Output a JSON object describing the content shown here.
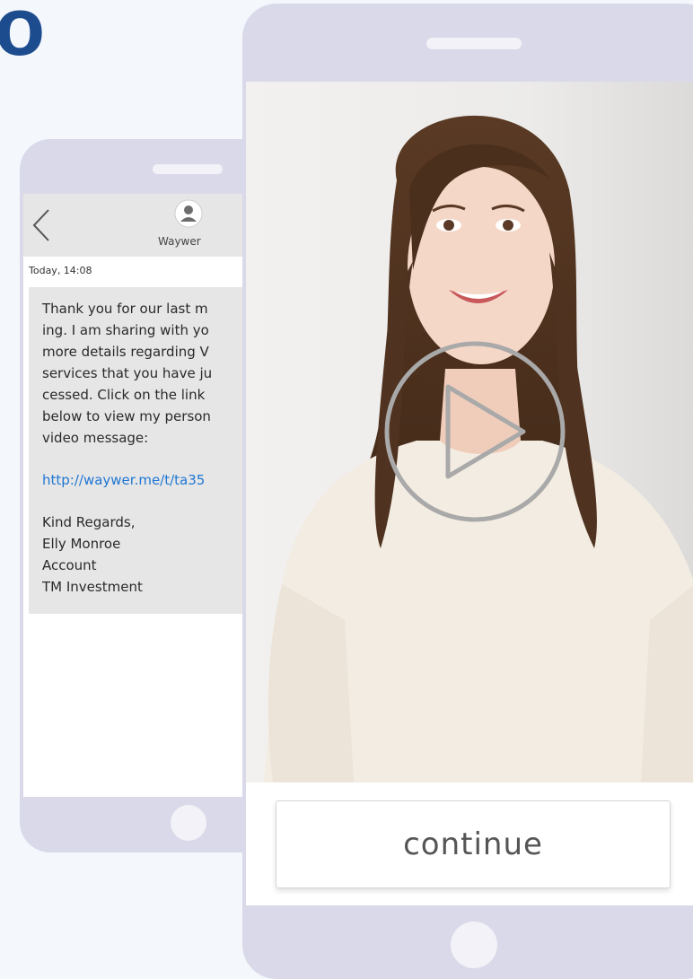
{
  "headline": {
    "fragment": "o"
  },
  "message_app": {
    "contact_name": "Waywer",
    "timestamp": "Today, 14:08",
    "message_lines": [
      "Thank you for our last m",
      "ing. I am sharing with yo",
      "more details regarding V",
      "services that you have ju",
      "cessed. Click on the link",
      "below to view my person",
      "video message:"
    ],
    "link": "http://waywer.me/t/ta35",
    "signature_lines": [
      "Kind Regards,",
      "Elly Monroe",
      "Account",
      "TM Investment"
    ]
  },
  "video_player": {
    "continue_label": "continue"
  },
  "colors": {
    "phone_frame": "#d9d9e9",
    "headline": "#1d4c8e",
    "link": "#1f77d3",
    "bubble": "#e6e6e6"
  },
  "icons": {
    "back": "chevron-left-icon",
    "contact": "user-avatar-icon",
    "play": "play-icon"
  }
}
